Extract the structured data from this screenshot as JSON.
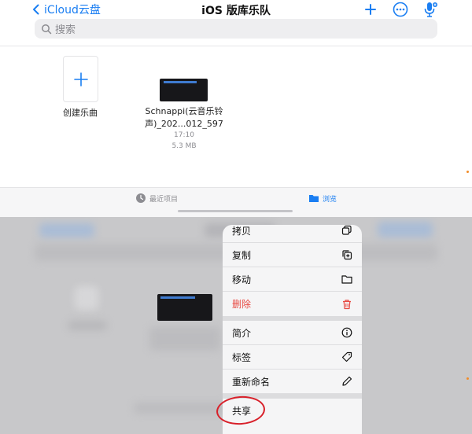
{
  "navbar": {
    "back_label": "iCloud云盘",
    "title": "iOS 版库乐队"
  },
  "search": {
    "placeholder": "搜索"
  },
  "grid": {
    "create": {
      "label": "创建乐曲"
    },
    "file": {
      "name_line1": "Schnappi(云音乐铃",
      "name_line2": "声)_202...012_597",
      "time": "17:10",
      "size": "5.3 MB"
    }
  },
  "tabbar": {
    "recent_label": "最近项目",
    "browse_label": "浏览"
  },
  "menu": {
    "items": [
      {
        "label": "拷贝",
        "icon": "copy-icon"
      },
      {
        "label": "复制",
        "icon": "duplicate-icon"
      },
      {
        "label": "移动",
        "icon": "folder-icon"
      },
      {
        "label": "删除",
        "icon": "trash-icon"
      },
      {
        "label": "简介",
        "icon": "info-icon"
      },
      {
        "label": "标签",
        "icon": "tag-icon"
      },
      {
        "label": "重新命名",
        "icon": "pencil-icon"
      },
      {
        "label": "共享",
        "icon": "share-icon"
      }
    ]
  },
  "colors": {
    "accent": "#1a7ef2",
    "destructive": "#e84b44",
    "annotation": "#d8202a"
  }
}
